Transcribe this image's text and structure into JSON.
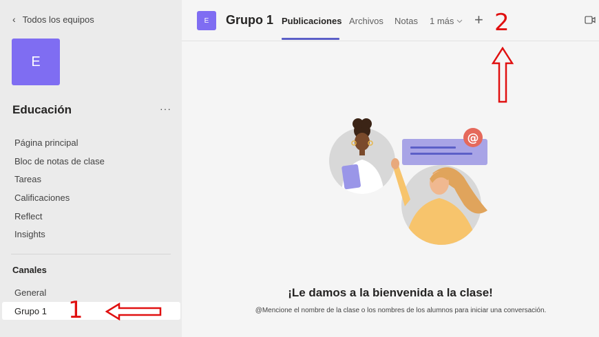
{
  "sidebar": {
    "back_label": "Todos los equipos",
    "team_initial": "E",
    "team_name": "Educación",
    "more_label": "···",
    "nav_items": [
      {
        "label": "Página principal"
      },
      {
        "label": "Bloc de notas de clase"
      },
      {
        "label": "Tareas"
      },
      {
        "label": "Calificaciones"
      },
      {
        "label": "Reflect"
      },
      {
        "label": "Insights"
      }
    ],
    "channels_header": "Canales",
    "channels": [
      {
        "label": "General"
      },
      {
        "label": "Grupo 1"
      }
    ]
  },
  "header": {
    "channel_initial": "E",
    "channel_name": "Grupo 1",
    "tabs": [
      {
        "label": "Publicaciones"
      },
      {
        "label": "Archivos"
      },
      {
        "label": "Notas"
      },
      {
        "label": "1 más"
      }
    ],
    "add_tab_label": "+"
  },
  "main": {
    "welcome_title": "¡Le damos a la bienvenida a la clase!",
    "welcome_subtitle": "@Mencione el nombre de la clase o los nombres de los alumnos para iniciar una conversación."
  },
  "annotations": {
    "marker_1": "1",
    "marker_2": "2",
    "color": "#e01010"
  },
  "colors": {
    "accent": "#5b5fc7",
    "avatar": "#7f6df2"
  }
}
